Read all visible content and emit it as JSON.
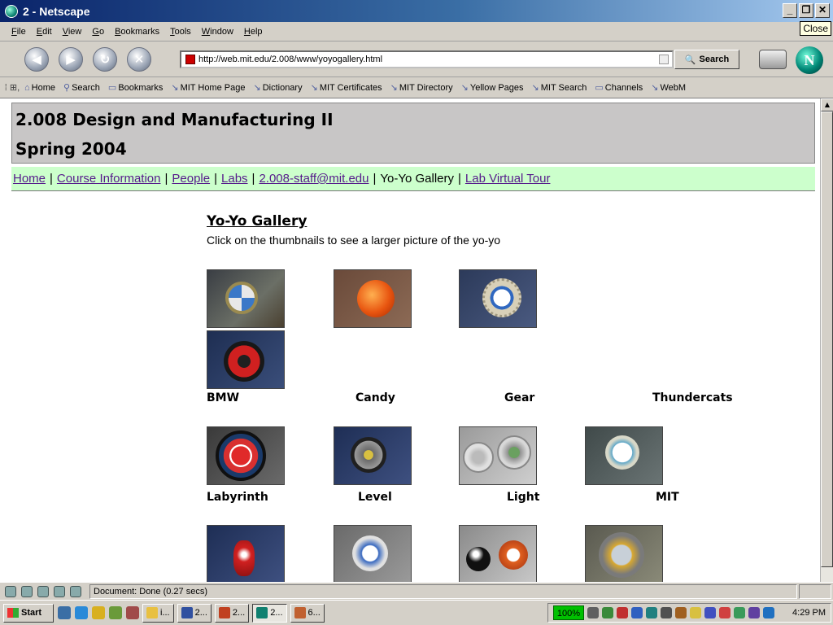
{
  "window": {
    "title": "2 - Netscape",
    "close_tooltip": "Close"
  },
  "menu": [
    "File",
    "Edit",
    "View",
    "Go",
    "Bookmarks",
    "Tools",
    "Window",
    "Help"
  ],
  "navbar": {
    "url": "http://web.mit.edu/2.008/www/yoyogallery.html",
    "search_label": "Search"
  },
  "personal_toolbar": {
    "items": [
      "Home",
      "Search",
      "Bookmarks",
      "MIT Home Page",
      "Dictionary",
      "MIT Certificates",
      "MIT Directory",
      "Yellow Pages",
      "MIT Search",
      "Channels",
      "WebM"
    ]
  },
  "page": {
    "course_title": "2.008 Design and Manufacturing II",
    "course_term": "Spring 2004",
    "nav_links": [
      {
        "label": "Home",
        "current": false
      },
      {
        "label": "Course Information",
        "current": false
      },
      {
        "label": "People",
        "current": false
      },
      {
        "label": "Labs",
        "current": false
      },
      {
        "label": "2.008-staff@mit.edu",
        "current": false
      },
      {
        "label": "Yo-Yo Gallery",
        "current": true
      },
      {
        "label": "Lab Virtual Tour",
        "current": false
      }
    ],
    "gallery_title": "Yo-Yo Gallery",
    "gallery_subtitle": "Click on the thumbnails to see a larger picture of the yo-yo",
    "rows": [
      {
        "labels": [
          "BMW",
          "Candy",
          "Gear",
          "Thundercats"
        ]
      },
      {
        "labels": [
          "Labyrinth",
          "Level",
          "Light",
          "MIT"
        ]
      },
      {
        "labels": []
      }
    ]
  },
  "status": {
    "text": "Document: Done (0.27 secs)"
  },
  "taskbar": {
    "start": "Start",
    "tasks": [
      "i...",
      "2...",
      "2...",
      "2...",
      "6..."
    ],
    "zoom": "100%",
    "clock": "4:29 PM"
  },
  "colors": {
    "nav_bg": "#ccffcc",
    "header_bg": "#c8c6c6",
    "link": "#551a8b",
    "titlebar": "#0a246a"
  }
}
